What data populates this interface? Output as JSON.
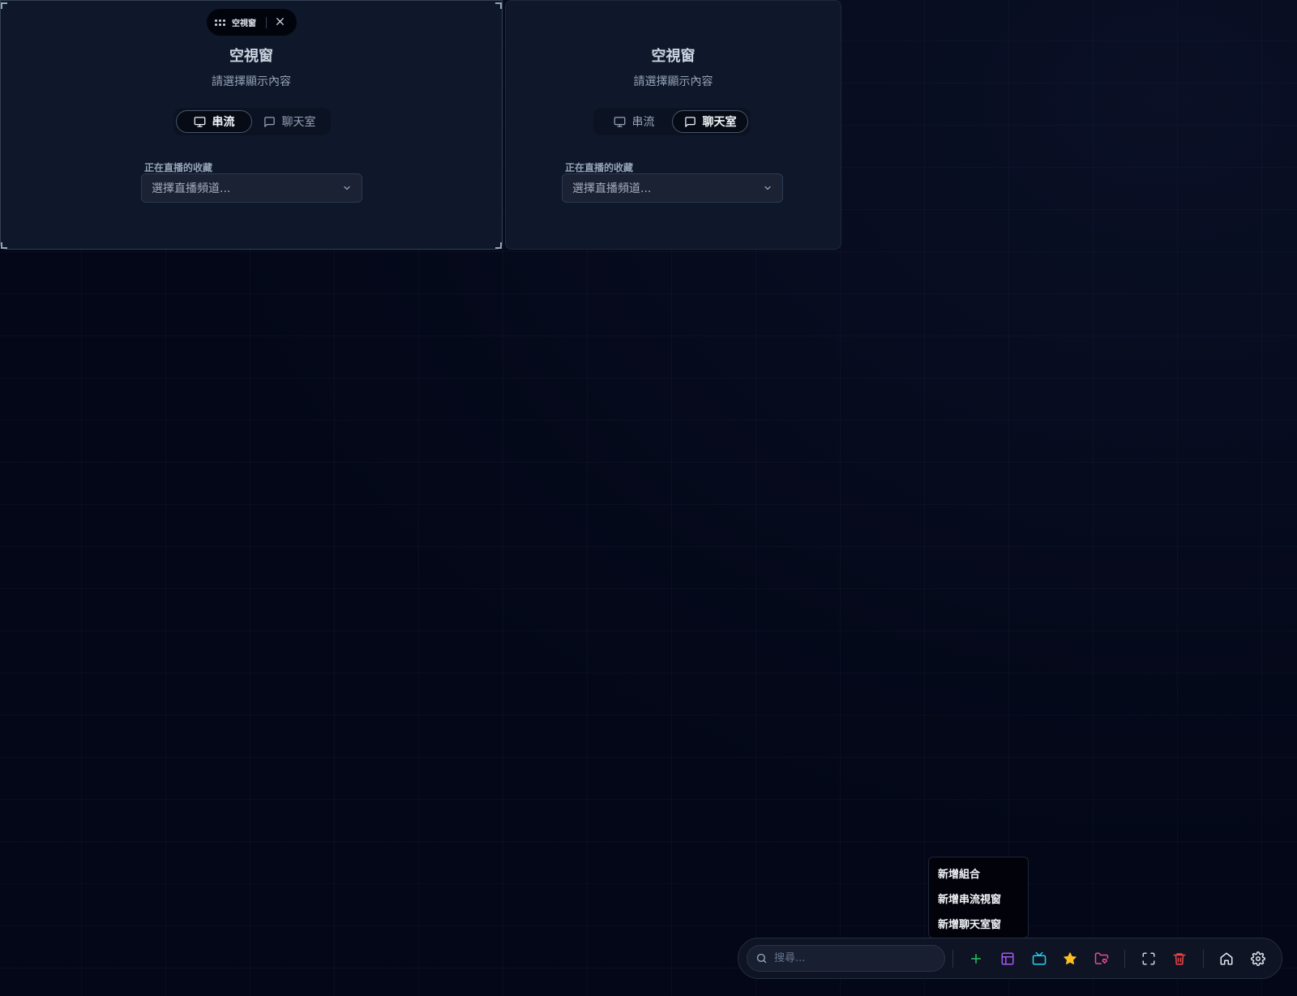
{
  "panels": [
    {
      "header_title": "空視窗",
      "title": "空視窗",
      "subtitle": "請選擇顯示內容",
      "tabs": [
        {
          "label": "串流",
          "icon": "monitor-icon",
          "active": true
        },
        {
          "label": "聊天室",
          "icon": "chat-bubble-icon",
          "active": false
        }
      ],
      "field_label": "正在直播的收藏",
      "select_value": "選擇直播頻道..."
    },
    {
      "title": "空視窗",
      "subtitle": "請選擇顯示內容",
      "tabs": [
        {
          "label": "串流",
          "icon": "monitor-icon",
          "active": false
        },
        {
          "label": "聊天室",
          "icon": "chat-bubble-icon",
          "active": true
        }
      ],
      "field_label": "正在直播的收藏",
      "select_value": "選擇直播頻道..."
    }
  ],
  "add_menu": {
    "items": [
      "新增組合",
      "新增串流視窗",
      "新增聊天室窗"
    ]
  },
  "toolbar": {
    "search_placeholder": "搜尋...",
    "buttons": [
      {
        "name": "add-button",
        "icon": "plus-icon",
        "color": "#22c55e"
      },
      {
        "name": "layout-button",
        "icon": "layout-icon",
        "color": "#a855f7"
      },
      {
        "name": "tv-button",
        "icon": "tv-icon",
        "color": "#22d3ee"
      },
      {
        "name": "favorites-button",
        "icon": "star-icon",
        "color": "#fbbf24"
      },
      {
        "name": "folder-button",
        "icon": "folder-heart-icon",
        "color": "#ec4899"
      },
      {
        "name": "fullscreen-button",
        "icon": "fullscreen-icon",
        "color": "#cbd5e1"
      },
      {
        "name": "delete-button",
        "icon": "trash-icon",
        "color": "#ef4444"
      },
      {
        "name": "home-button",
        "icon": "home-icon",
        "color": "#e2e8f0"
      },
      {
        "name": "settings-button",
        "icon": "gear-icon",
        "color": "#e2e8f0"
      }
    ]
  }
}
